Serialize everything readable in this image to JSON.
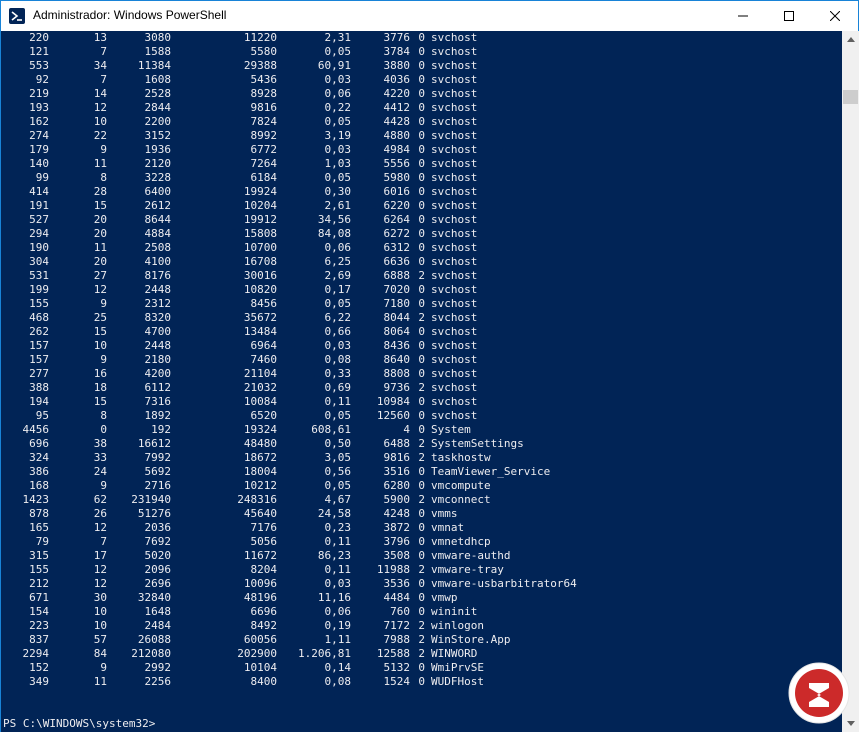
{
  "window": {
    "title": "Administrador: Windows PowerShell",
    "app_icon": "powershell-icon",
    "controls": [
      "minimize-icon",
      "maximize-icon",
      "close-icon"
    ]
  },
  "colors": {
    "console_bg": "#012456",
    "console_fg": "#eeedf0",
    "window_border": "#1883d7"
  },
  "processes": [
    [
      "220",
      "13",
      "3080",
      "11220",
      "2,31",
      "3776",
      "0",
      "svchost"
    ],
    [
      "121",
      "7",
      "1588",
      "5580",
      "0,05",
      "3784",
      "0",
      "svchost"
    ],
    [
      "553",
      "34",
      "11384",
      "29388",
      "60,91",
      "3880",
      "0",
      "svchost"
    ],
    [
      "92",
      "7",
      "1608",
      "5436",
      "0,03",
      "4036",
      "0",
      "svchost"
    ],
    [
      "219",
      "14",
      "2528",
      "8928",
      "0,06",
      "4220",
      "0",
      "svchost"
    ],
    [
      "193",
      "12",
      "2844",
      "9816",
      "0,22",
      "4412",
      "0",
      "svchost"
    ],
    [
      "162",
      "10",
      "2200",
      "7824",
      "0,05",
      "4428",
      "0",
      "svchost"
    ],
    [
      "274",
      "22",
      "3152",
      "8992",
      "3,19",
      "4880",
      "0",
      "svchost"
    ],
    [
      "179",
      "9",
      "1936",
      "6772",
      "0,03",
      "4984",
      "0",
      "svchost"
    ],
    [
      "140",
      "11",
      "2120",
      "7264",
      "1,03",
      "5556",
      "0",
      "svchost"
    ],
    [
      "99",
      "8",
      "3228",
      "6184",
      "0,05",
      "5980",
      "0",
      "svchost"
    ],
    [
      "414",
      "28",
      "6400",
      "19924",
      "0,30",
      "6016",
      "0",
      "svchost"
    ],
    [
      "191",
      "15",
      "2612",
      "10204",
      "2,61",
      "6220",
      "0",
      "svchost"
    ],
    [
      "527",
      "20",
      "8644",
      "19912",
      "34,56",
      "6264",
      "0",
      "svchost"
    ],
    [
      "294",
      "20",
      "4884",
      "15808",
      "84,08",
      "6272",
      "0",
      "svchost"
    ],
    [
      "190",
      "11",
      "2508",
      "10700",
      "0,06",
      "6312",
      "0",
      "svchost"
    ],
    [
      "304",
      "20",
      "4100",
      "16708",
      "6,25",
      "6636",
      "0",
      "svchost"
    ],
    [
      "531",
      "27",
      "8176",
      "30016",
      "2,69",
      "6888",
      "2",
      "svchost"
    ],
    [
      "199",
      "12",
      "2448",
      "10820",
      "0,17",
      "7020",
      "0",
      "svchost"
    ],
    [
      "155",
      "9",
      "2312",
      "8456",
      "0,05",
      "7180",
      "0",
      "svchost"
    ],
    [
      "468",
      "25",
      "8320",
      "35672",
      "6,22",
      "8044",
      "2",
      "svchost"
    ],
    [
      "262",
      "15",
      "4700",
      "13484",
      "0,66",
      "8064",
      "0",
      "svchost"
    ],
    [
      "157",
      "10",
      "2448",
      "6964",
      "0,03",
      "8436",
      "0",
      "svchost"
    ],
    [
      "157",
      "9",
      "2180",
      "7460",
      "0,08",
      "8640",
      "0",
      "svchost"
    ],
    [
      "277",
      "16",
      "4200",
      "21104",
      "0,33",
      "8808",
      "0",
      "svchost"
    ],
    [
      "388",
      "18",
      "6112",
      "21032",
      "0,69",
      "9736",
      "2",
      "svchost"
    ],
    [
      "194",
      "15",
      "7316",
      "10084",
      "0,11",
      "10984",
      "0",
      "svchost"
    ],
    [
      "95",
      "8",
      "1892",
      "6520",
      "0,05",
      "12560",
      "0",
      "svchost"
    ],
    [
      "4456",
      "0",
      "192",
      "19324",
      "608,61",
      "4",
      "0",
      "System"
    ],
    [
      "696",
      "38",
      "16612",
      "48480",
      "0,50",
      "6488",
      "2",
      "SystemSettings"
    ],
    [
      "324",
      "33",
      "7992",
      "18672",
      "3,05",
      "9816",
      "2",
      "taskhostw"
    ],
    [
      "386",
      "24",
      "5692",
      "18004",
      "0,56",
      "3516",
      "0",
      "TeamViewer_Service"
    ],
    [
      "168",
      "9",
      "2716",
      "10212",
      "0,05",
      "6280",
      "0",
      "vmcompute"
    ],
    [
      "1423",
      "62",
      "231940",
      "248316",
      "4,67",
      "5900",
      "2",
      "vmconnect"
    ],
    [
      "878",
      "26",
      "51276",
      "45640",
      "24,58",
      "4248",
      "0",
      "vmms"
    ],
    [
      "165",
      "12",
      "2036",
      "7176",
      "0,23",
      "3872",
      "0",
      "vmnat"
    ],
    [
      "79",
      "7",
      "7692",
      "5056",
      "0,11",
      "3796",
      "0",
      "vmnetdhcp"
    ],
    [
      "315",
      "17",
      "5020",
      "11672",
      "86,23",
      "3508",
      "0",
      "vmware-authd"
    ],
    [
      "155",
      "12",
      "2096",
      "8204",
      "0,11",
      "11988",
      "2",
      "vmware-tray"
    ],
    [
      "212",
      "12",
      "2696",
      "10096",
      "0,03",
      "3536",
      "0",
      "vmware-usbarbitrator64"
    ],
    [
      "671",
      "30",
      "32840",
      "48196",
      "11,16",
      "4484",
      "0",
      "vmwp"
    ],
    [
      "154",
      "10",
      "1648",
      "6696",
      "0,06",
      "760",
      "0",
      "wininit"
    ],
    [
      "223",
      "10",
      "2484",
      "8492",
      "0,19",
      "7172",
      "2",
      "winlogon"
    ],
    [
      "837",
      "57",
      "26088",
      "60056",
      "1,11",
      "7988",
      "2",
      "WinStore.App"
    ],
    [
      "2294",
      "84",
      "212080",
      "202900",
      "1.206,81",
      "12588",
      "2",
      "WINWORD"
    ],
    [
      "152",
      "9",
      "2992",
      "10104",
      "0,14",
      "5132",
      "0",
      "WmiPrvSE"
    ],
    [
      "349",
      "11",
      "2256",
      "8400",
      "0,08",
      "1524",
      "0",
      "WUDFHost"
    ]
  ],
  "prompt": "PS C:\\WINDOWS\\system32>",
  "scrollbar": {
    "up_icon": "scroll-up-arrow-icon",
    "down_icon": "scroll-down-arrow-icon"
  },
  "watermark": {
    "icon": "logo-watermark-icon"
  }
}
